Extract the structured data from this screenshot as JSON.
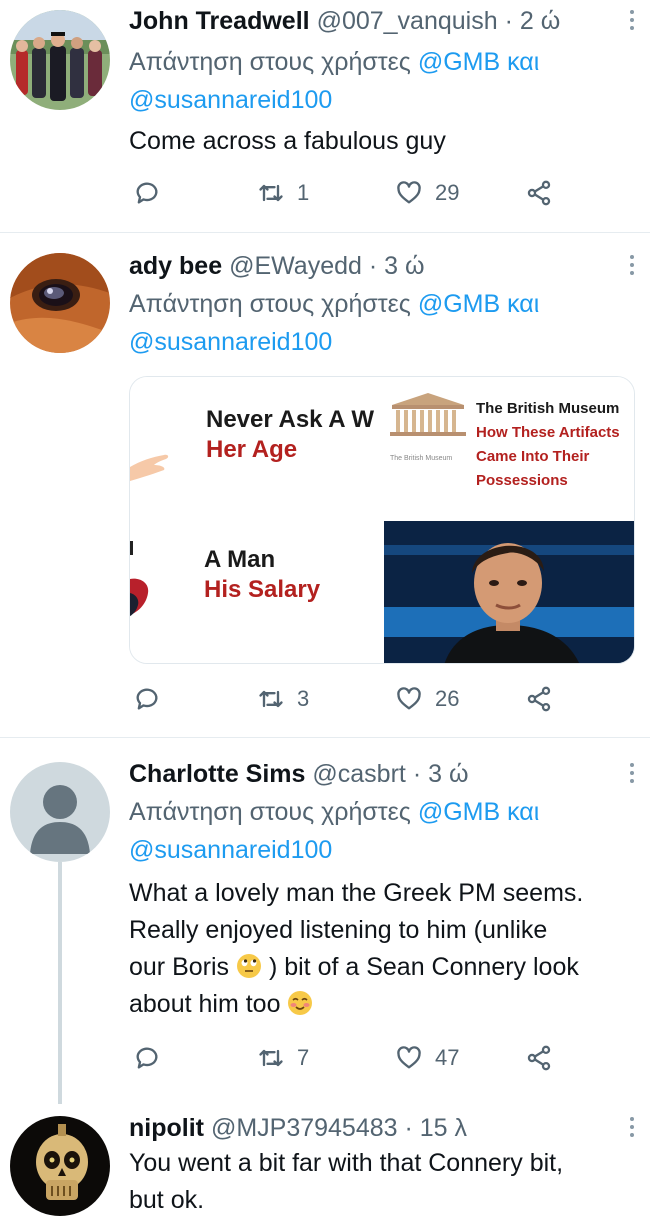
{
  "tweets": [
    {
      "display_name": "John Treadwell",
      "handle": "@007_vanquish",
      "separator": "·",
      "time": "2 ώ",
      "reply_prefix": "Απάντηση στους χρήστες",
      "reply_mention_1": "@GMB",
      "reply_and": "και",
      "reply_mention_2": "@susannareid100",
      "text": "Come across a fabulous guy",
      "counts": {
        "reply": "",
        "retweet": "1",
        "like": "29"
      },
      "avatar_icon": "group-photo-avatar"
    },
    {
      "display_name": "ady bee",
      "handle": "@EWayedd",
      "separator": "·",
      "time": "3 ώ",
      "reply_prefix": "Απάντηση στους χρήστες",
      "reply_mention_1": "@GMB",
      "reply_and": "και",
      "reply_mention_2": "@susannareid100",
      "counts": {
        "reply": "",
        "retweet": "3",
        "like": "26"
      },
      "avatar_icon": "horse-eye-avatar",
      "media": {
        "ad1_title": "Never Ask A W",
        "ad1_sub": "Her Age",
        "ad2_title": "The British Museum",
        "ad2_sub": "How These Artifacts Came Into Their Possessions",
        "ad2_caption": "The British Museum",
        "ad3_title": "A Man",
        "ad3_sub": "His Salary"
      }
    },
    {
      "display_name": "Charlotte Sims",
      "handle": "@casbrt",
      "separator": "·",
      "time": "3 ώ",
      "reply_prefix": "Απάντηση στους χρήστες",
      "reply_mention_1": "@GMB",
      "reply_and": "και",
      "reply_mention_2": "@susannareid100",
      "text_lines": [
        "What a lovely man the Greek PM seems.",
        "Really enjoyed listening to him (unlike",
        "our Boris",
        ") bit of a Sean Connery look",
        "about him too"
      ],
      "counts": {
        "reply": "",
        "retweet": "7",
        "like": "47"
      },
      "avatar_icon": "default-person-avatar"
    },
    {
      "display_name": "nipolit",
      "handle": "@MJP37945483",
      "separator": "·",
      "time": "15 λ",
      "text_lines": [
        "You went a bit far with that Connery bit,",
        "but ok."
      ],
      "avatar_icon": "skull-avatar"
    }
  ],
  "colors": {
    "link": "#1d9bf0",
    "secondary_text": "#536471",
    "primary_text": "#0f1419",
    "divider": "#e6ecf0",
    "ad_red": "#b3211f"
  }
}
